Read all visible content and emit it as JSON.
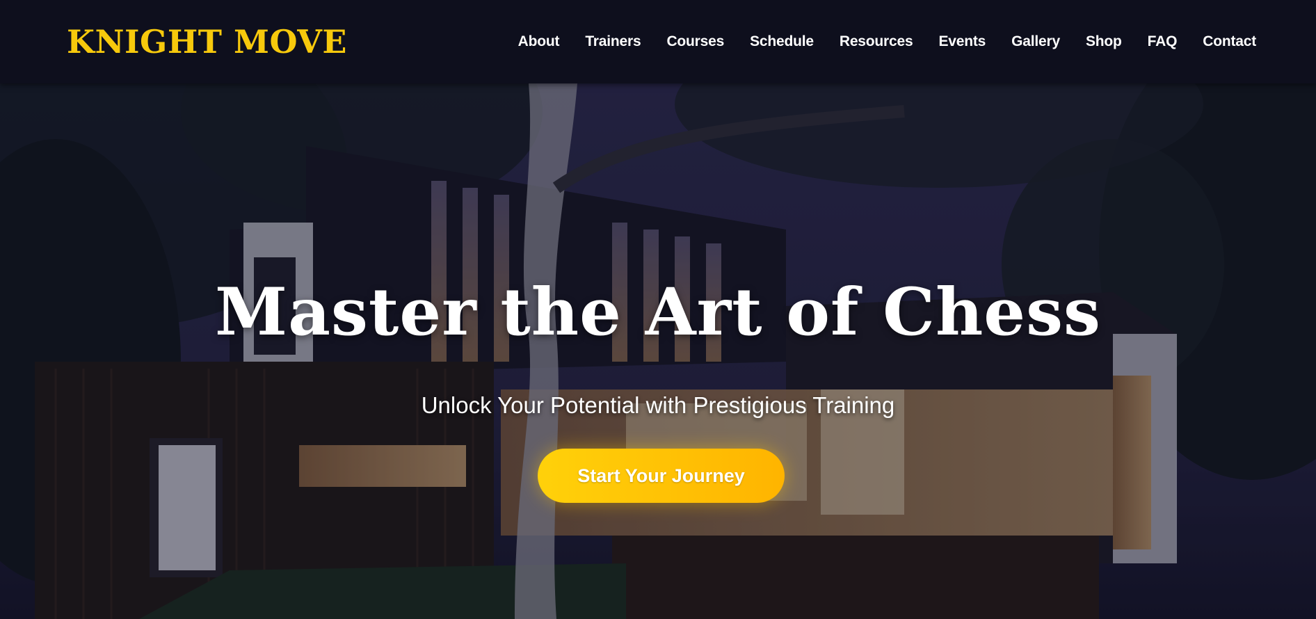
{
  "brand": {
    "logo_text": "KNIGHT MOVE",
    "accent_color": "#f7c90c"
  },
  "nav": {
    "items": [
      {
        "label": "About"
      },
      {
        "label": "Trainers"
      },
      {
        "label": "Courses"
      },
      {
        "label": "Schedule"
      },
      {
        "label": "Resources"
      },
      {
        "label": "Events"
      },
      {
        "label": "Gallery"
      },
      {
        "label": "Shop"
      },
      {
        "label": "FAQ"
      },
      {
        "label": "Contact"
      }
    ]
  },
  "hero": {
    "title": "Master the Art of Chess",
    "subtitle": "Unlock Your Potential with Prestigious Training",
    "cta_label": "Start Your Journey",
    "cta_gradient": [
      "#ffd10a",
      "#ffb400"
    ],
    "background_image": "night-modern-house-photo"
  }
}
